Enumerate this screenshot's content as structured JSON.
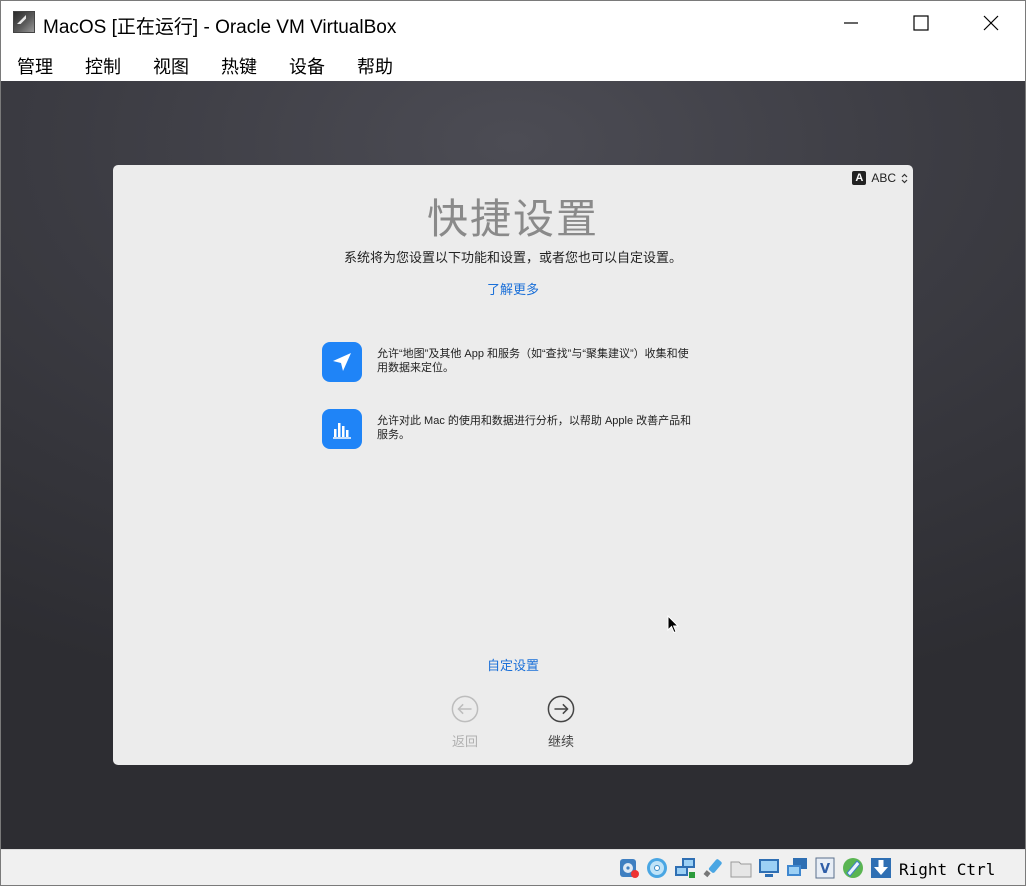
{
  "window": {
    "title": "MacOS [正在运行] - Oracle VM VirtualBox",
    "minimize_glyph": "minimize",
    "maximize_glyph": "maximize",
    "close_glyph": "close"
  },
  "menubar": {
    "items": [
      "管理",
      "控制",
      "视图",
      "热键",
      "设备",
      "帮助"
    ]
  },
  "guest": {
    "input_source": {
      "badge": "A",
      "label": "ABC"
    },
    "heading": "快捷设置",
    "subtitle": "系统将为您设置以下功能和设置，或者您也可以自定设置。",
    "learn_more": "了解更多",
    "features": [
      {
        "icon": "location-arrow-icon",
        "text": "允许“地图”及其他 App 和服务（如“查找”与“聚集建议”）收集和使用数据来定位。"
      },
      {
        "icon": "analytics-chart-icon",
        "text": "允许对此 Mac 的使用和数据进行分析，以帮助 Apple 改善产品和服务。"
      }
    ],
    "customize_link": "自定设置",
    "back_label": "返回",
    "continue_label": "继续"
  },
  "statusbar": {
    "host_key": "Right Ctrl",
    "icons": [
      "hard-disk-icon",
      "optical-drive-icon",
      "network-icon",
      "usb-icon",
      "shared-folder-icon",
      "display-icon",
      "capture-icon",
      "recording-icon",
      "guest-additions-icon",
      "mouse-integration-icon",
      "keyboard-capture-icon"
    ]
  },
  "colors": {
    "accent_blue": "#1f84f7",
    "link_blue": "#1a6fd8",
    "panel_bg": "#ececec",
    "vm_bg": "#3c3c43"
  }
}
